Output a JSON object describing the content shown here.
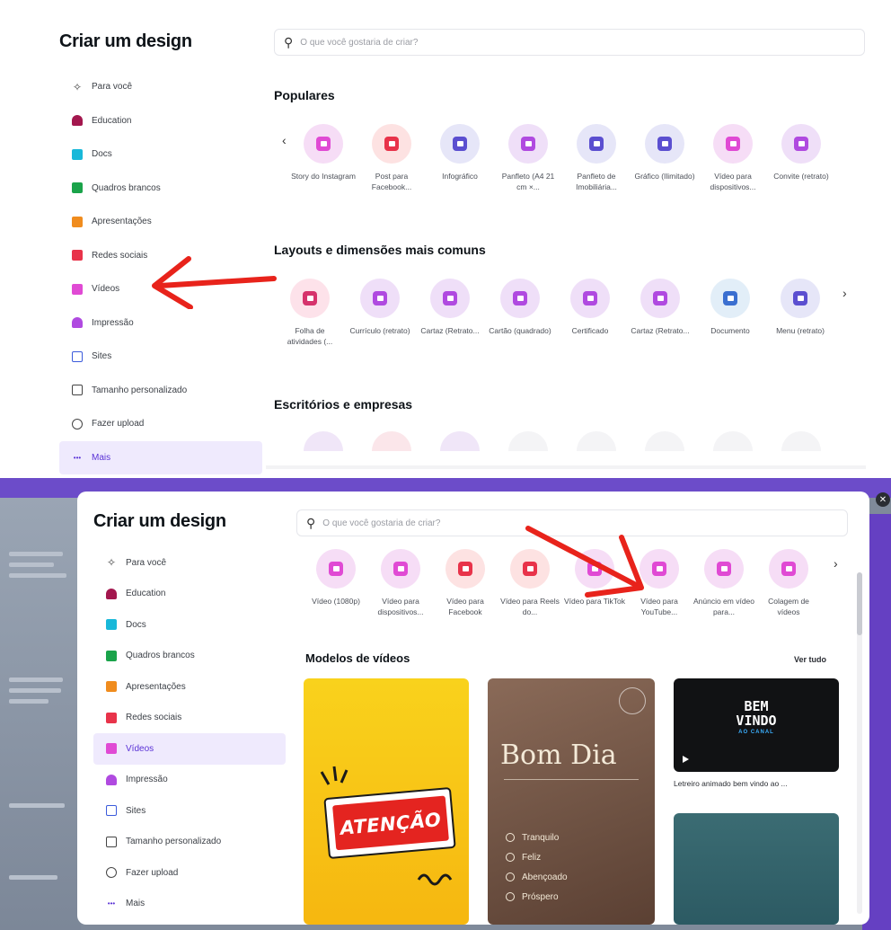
{
  "top_panel": {
    "title": "Criar um design",
    "search_placeholder": "O que você gostaria de criar?",
    "sidebar": [
      {
        "label": "Para você",
        "icon": "sparkle-icon",
        "color": "#444444"
      },
      {
        "label": "Education",
        "icon": "graduation-cap-icon",
        "color": "#a3174e"
      },
      {
        "label": "Docs",
        "icon": "docs-icon",
        "color": "#18b8d9"
      },
      {
        "label": "Quadros brancos",
        "icon": "whiteboard-icon",
        "color": "#1aa34a"
      },
      {
        "label": "Apresentações",
        "icon": "presentation-icon",
        "color": "#f08c1e"
      },
      {
        "label": "Redes sociais",
        "icon": "social-media-icon",
        "color": "#e8334a"
      },
      {
        "label": "Vídeos",
        "icon": "video-icon",
        "color": "#e04ad4"
      },
      {
        "label": "Impressão",
        "icon": "print-icon",
        "color": "#b04ae0"
      },
      {
        "label": "Sites",
        "icon": "sites-icon",
        "color": "#3b5bdb"
      },
      {
        "label": "Tamanho personalizado",
        "icon": "custom-size-icon",
        "color": "#444444"
      },
      {
        "label": "Fazer upload",
        "icon": "upload-icon",
        "color": "#444444"
      },
      {
        "label": "Mais",
        "icon": "more-icon",
        "color": "#5a32d6"
      }
    ],
    "popular": {
      "heading": "Populares",
      "items": [
        {
          "label": "Story do Instagram",
          "bg": "#f6ddf6",
          "fg": "#e04ad4"
        },
        {
          "label": "Post para Facebook...",
          "bg": "#fde2e2",
          "fg": "#e8334a"
        },
        {
          "label": "Infográfico",
          "bg": "#e6e6f8",
          "fg": "#5b4fd0"
        },
        {
          "label": "Panfleto (A4 21 cm ×...",
          "bg": "#efdff8",
          "fg": "#b04ae0"
        },
        {
          "label": "Panfleto de Imobiliária...",
          "bg": "#e6e6f8",
          "fg": "#5b4fd0"
        },
        {
          "label": "Gráfico (Ilimitado)",
          "bg": "#e6e6f8",
          "fg": "#5b4fd0"
        },
        {
          "label": "Vídeo para dispositivos...",
          "bg": "#f6ddf6",
          "fg": "#e04ad4"
        },
        {
          "label": "Convite (retrato)",
          "bg": "#efdff8",
          "fg": "#b04ae0"
        }
      ]
    },
    "layouts": {
      "heading": "Layouts e dimensões mais comuns",
      "items": [
        {
          "label": "Folha de atividades (...",
          "bg": "#fde2ea",
          "fg": "#d6336c"
        },
        {
          "label": "Currículo (retrato)",
          "bg": "#efdff8",
          "fg": "#b04ae0"
        },
        {
          "label": "Cartaz (Retrato...",
          "bg": "#efdff8",
          "fg": "#b04ae0"
        },
        {
          "label": "Cartão (quadrado)",
          "bg": "#efdff8",
          "fg": "#b04ae0"
        },
        {
          "label": "Certificado",
          "bg": "#efdff8",
          "fg": "#b04ae0"
        },
        {
          "label": "Cartaz (Retrato...",
          "bg": "#efdff8",
          "fg": "#b04ae0"
        },
        {
          "label": "Documento",
          "bg": "#e2eef8",
          "fg": "#3b6fd0"
        },
        {
          "label": "Menu (retrato)",
          "bg": "#e6e6f8",
          "fg": "#5b4fd0"
        }
      ]
    },
    "offices": {
      "heading": "Escritórios e empresas"
    }
  },
  "bottom_panel": {
    "title": "Criar um design",
    "search_placeholder": "O que você gostaria de criar?",
    "video_types": [
      {
        "label": "Vídeo (1080p)",
        "bg": "#f6ddf6",
        "fg": "#e04ad4"
      },
      {
        "label": "Vídeo para dispositivos...",
        "bg": "#f6ddf6",
        "fg": "#e04ad4"
      },
      {
        "label": "Vídeo para Facebook",
        "bg": "#fde2e2",
        "fg": "#e8334a"
      },
      {
        "label": "Vídeo para Reels do...",
        "bg": "#fde2e2",
        "fg": "#e8334a"
      },
      {
        "label": "Vídeo para TikTok",
        "bg": "#f6ddf6",
        "fg": "#e04ad4"
      },
      {
        "label": "Vídeo para YouTube...",
        "bg": "#f6ddf6",
        "fg": "#e04ad4"
      },
      {
        "label": "Anúncio em vídeo para...",
        "bg": "#f6ddf6",
        "fg": "#e04ad4"
      },
      {
        "label": "Colagem de vídeos",
        "bg": "#f6ddf6",
        "fg": "#e04ad4"
      }
    ],
    "templates": {
      "heading": "Modelos de vídeos",
      "see_all": "Ver tudo",
      "card1_text": "ATENÇÃO",
      "card2_title": "Bom Dia",
      "card2_list": [
        "Tranquilo",
        "Feliz",
        "Abençoado",
        "Próspero"
      ],
      "card3_line1": "BEM",
      "card3_line2": "VINDO",
      "card3_line3": "AO CANAL",
      "card3_caption": "Letreiro animado bem vindo ao ..."
    }
  },
  "annotations": {
    "arrow_color": "#e8231b"
  }
}
